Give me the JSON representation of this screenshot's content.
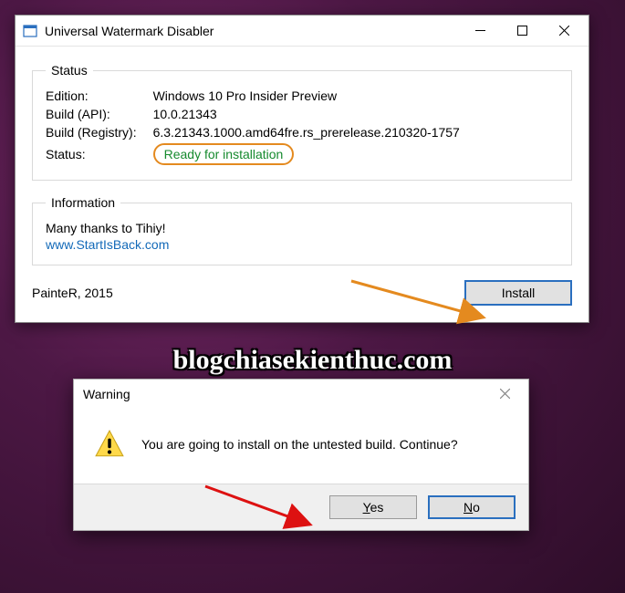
{
  "window": {
    "title": "Universal Watermark Disabler",
    "status_group": {
      "legend": "Status",
      "edition_key": "Edition:",
      "edition_val": "Windows 10 Pro Insider Preview",
      "build_api_key": "Build (API):",
      "build_api_val": "10.0.21343",
      "build_reg_key": "Build (Registry):",
      "build_reg_val": "6.3.21343.1000.amd64fre.rs_prerelease.210320-1757",
      "status_key": "Status:",
      "status_val": "Ready for installation"
    },
    "info_group": {
      "legend": "Information",
      "thanks": "Many thanks to Tihiy!",
      "link": "www.StartIsBack.com"
    },
    "credit": "PainteR, 2015",
    "install_label": "Install"
  },
  "overlay_text": "blogchiasekienthuc.com",
  "dialog": {
    "title": "Warning",
    "message": "You are going to install on the untested build. Continue?",
    "yes": "Yes",
    "no": "No"
  },
  "colors": {
    "highlight_border": "#e48a1f",
    "ready_text": "#168a2e",
    "link": "#1269b8",
    "focus_border": "#2a6fbf"
  }
}
